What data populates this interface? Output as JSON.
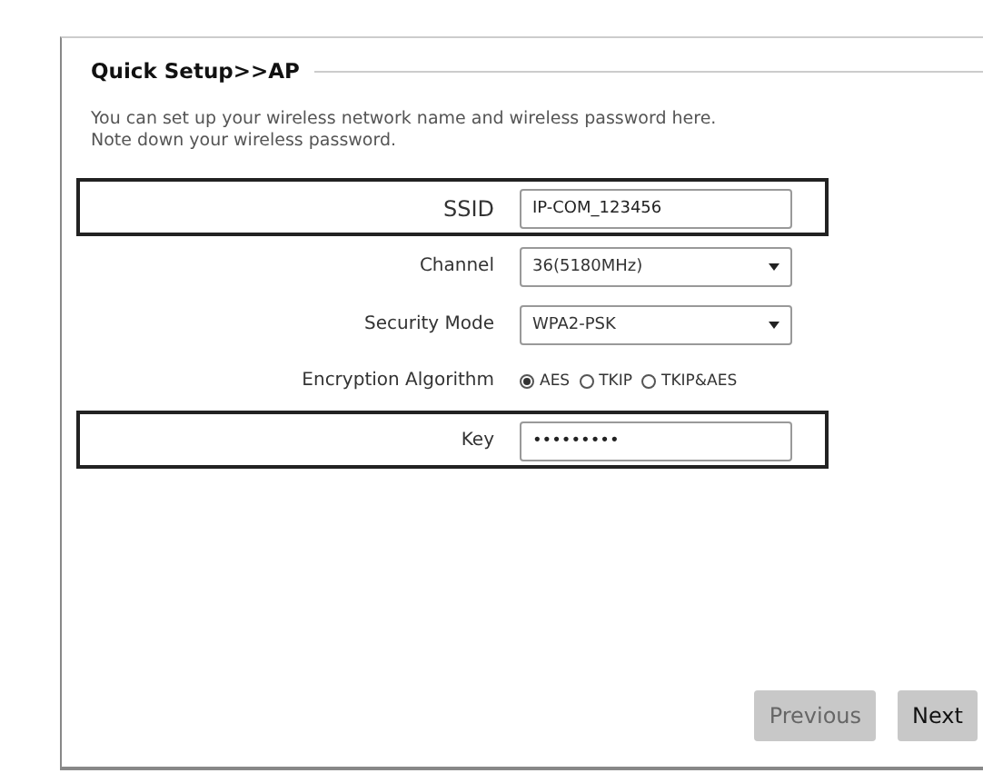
{
  "section_title": "Quick Setup>>AP",
  "description": "You can set up your wireless network name and wireless password here.\nNote down your wireless password.",
  "ssid": {
    "label": "SSID",
    "value": "IP-COM_123456",
    "highlighted": true
  },
  "channel": {
    "label": "Channel",
    "value": "36(5180MHz)"
  },
  "security_mode": {
    "label": "Security Mode",
    "value": "WPA2-PSK"
  },
  "encryption": {
    "label": "Encryption Algorithm",
    "options": [
      {
        "label": "AES",
        "selected": true
      },
      {
        "label": "TKIP",
        "selected": false
      },
      {
        "label": "TKIP&AES",
        "selected": false
      }
    ]
  },
  "key": {
    "label": "Key",
    "value": "•••••••••",
    "highlighted": true
  },
  "buttons": [
    {
      "label": "Previous",
      "disabled": true
    },
    {
      "label": "Next",
      "disabled": false
    }
  ]
}
